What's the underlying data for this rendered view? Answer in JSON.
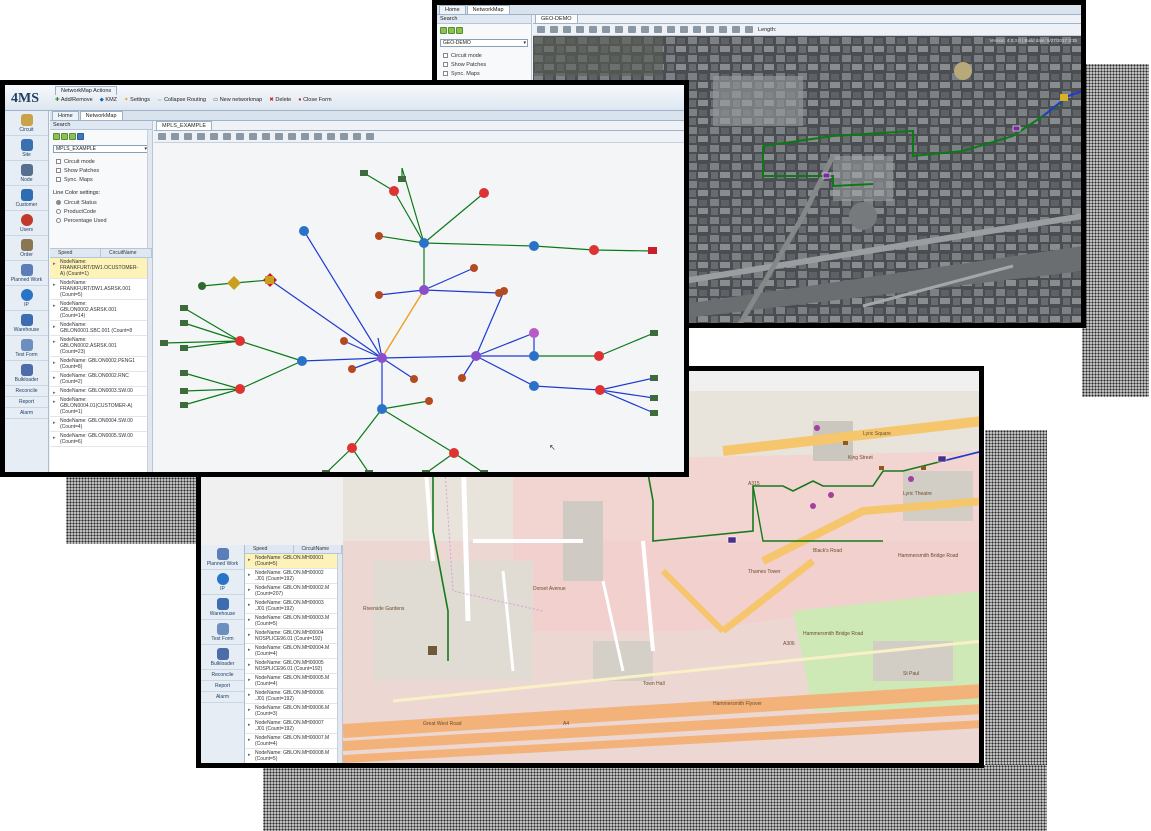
{
  "geo_window": {
    "tabs": [
      "Home",
      "NetworkMap"
    ],
    "search_title": "Search",
    "select_value": "GEO-DEMO",
    "options": [
      "Circuit mode",
      "Show Patches",
      "Sync. Maps"
    ],
    "doc_tab": "GEO-DEMO",
    "length_label": "Length:",
    "version_text": "Version: 4.0.3.0 | Build date: 5/27/2017 3:35"
  },
  "main_window": {
    "logo": "4MS",
    "actions_title": "NetworkMap Actions",
    "actions": [
      "Add/Remove",
      "KMZ",
      "Settings",
      "Collapse Routing",
      "New networkmap",
      "Delete",
      "Close Form"
    ],
    "tabs": [
      "Home",
      "NetworkMap"
    ],
    "search_title": "Search",
    "select_value": "MPLS_EXAMPLE",
    "options": [
      "Circuit mode",
      "Show Patches",
      "Sync. Maps"
    ],
    "line_color_title": "Line Color settings:",
    "line_color_options": [
      "Circuit Status",
      "ProductCode",
      "Percentage Used"
    ],
    "list_headers": [
      "Speed",
      "CircuitName"
    ],
    "list_items": [
      "NodeName:\nFRANKFURT/DW1.OCUSTOMER-\nA) (Count=1)",
      "NodeName:\nFRANKFURT/DW1.ASRSK.001\n(Count=5)",
      "NodeName:\nGBLON0002.ASRSK.001\n(Count=14)",
      "NodeName:\nGBLON0001.SBC.001 (Count=8",
      "NodeName:\nGBLON0002.ASRSK.001\n(Count=23)",
      "NodeName: GBLON0002.PENG1\n(Count=8)",
      "NodeName: GBLON0002.RNC\n(Count=2)",
      "NodeName: GBLON0003.SW.00",
      "NodeName:\nGBLON0004.01(CUSTOMER-A)\n(Count=1)",
      "NodeName: GBLON0004.SW.00\n(Count=4)",
      "NodeName: GBLON0005.SW.00\n(Count=6)"
    ],
    "nav": [
      "Circuit",
      "Site",
      "Node",
      "Customer",
      "Users",
      "Order",
      "Planned Work",
      "IP",
      "Warehouse",
      "Test Form",
      "Bulkloader"
    ],
    "nav_links": [
      "Reconcile",
      "Report",
      "Alarm"
    ],
    "doc_tab": "MPLS_EXAMPLE"
  },
  "street_window": {
    "nav": [
      "Planned Work",
      "IP",
      "Warehouse",
      "Test Form",
      "Bulkloader"
    ],
    "nav_links": [
      "Reconcile",
      "Report",
      "Alarm"
    ],
    "list_headers": [
      "Speed",
      "CircuitName"
    ],
    "list_items": [
      "NodeName: GBLON.MH00001\n(Count=5)",
      "NodeName: GBLON.MH00002\n.J01 (Count=192)",
      "NodeName: GBLON.MH00002.M\n(Count=207)",
      "NodeName: GBLON.MH00003\n.J01 (Count=192)",
      "NodeName: GBLON.MH00003.M\n(Count=5)",
      "NodeName: GBLON.MH00004\nNOSPLICE96.01 (Count=192)",
      "NodeName: GBLON.MH00004.M\n(Count=4)",
      "NodeName: GBLON.MH00005\nNOSPLICE96.01 (Count=192)",
      "NodeName: GBLON.MH00005.M\n(Count=4)",
      "NodeName: GBLON.MH00006\n.J01 (Count=192)",
      "NodeName: GBLON.MH00006.M\n(Count=3)",
      "NodeName: GBLON.MH00007\n.J01 (Count=192)",
      "NodeName: GBLON.MH00007.M\n(Count=4)",
      "NodeName: GBLON.MH00008.M\n(Count=5)"
    ],
    "map_labels": {
      "lyric_square": "Lyric Square",
      "king_street": "King Street",
      "black_road": "Black's Road",
      "hammersmith_bridge_road": "Hammersmith Bridge Road",
      "great_west_road": "Great West Road",
      "hammersmith_flyover": "Hammersmith Flyover",
      "a4": "A4",
      "a306": "A306",
      "a315": "A315",
      "dorset_avenue": "Dorset Avenue",
      "riverside_gardens": "Riverside Gardens",
      "hammersmith_bridge_rd_label": "Hammersmith Bridge Road",
      "thames_tower": "Thames Tower",
      "lyric_theatre": "Lyric Theatre",
      "st_paul": "St Paul",
      "town_hall": "Town Hall"
    }
  }
}
